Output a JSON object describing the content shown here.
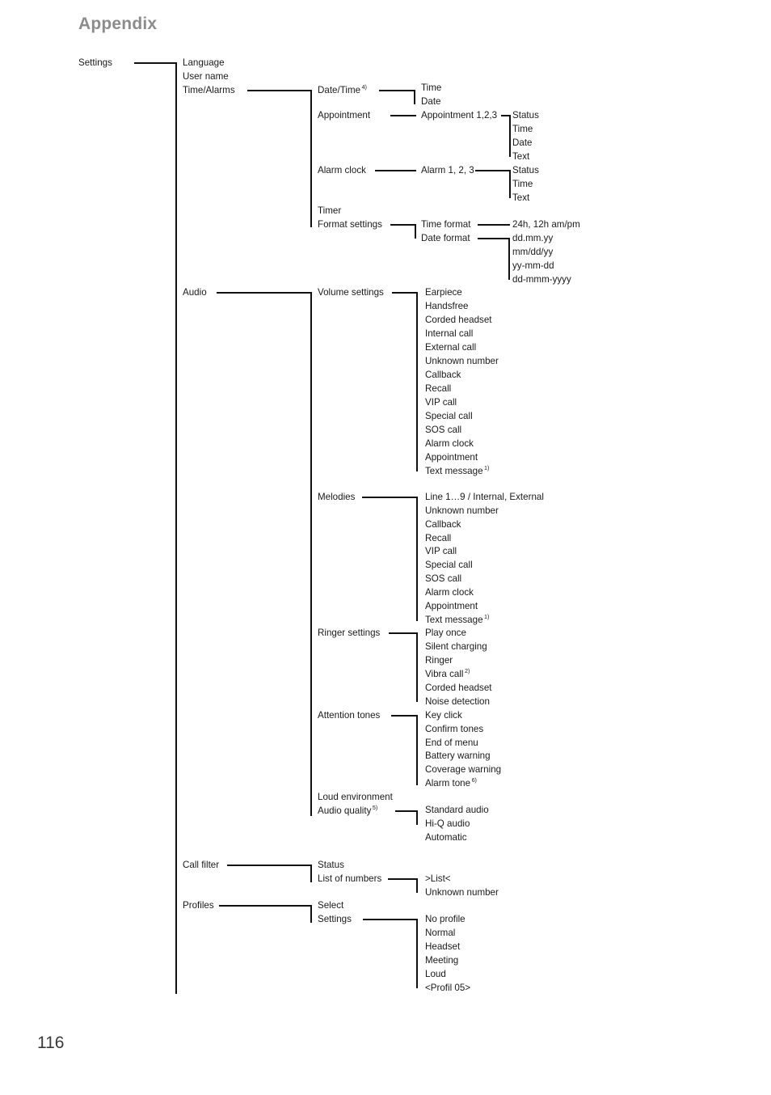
{
  "document": {
    "title": "Appendix",
    "page_number": "116"
  },
  "tree": {
    "root": {
      "label": "Settings"
    },
    "level1": [
      {
        "label": "Language"
      },
      {
        "label": "User name"
      },
      {
        "label": "Time/Alarms"
      },
      {
        "label": "Audio"
      },
      {
        "label": "Call filter"
      },
      {
        "label": "Profiles"
      }
    ],
    "level2": [
      {
        "label": "Date/Time",
        "footnote": "4)"
      },
      {
        "label": "Appointment"
      },
      {
        "label": "Alarm clock"
      },
      {
        "label": "Timer"
      },
      {
        "label": "Format settings"
      },
      {
        "label": "Volume settings"
      },
      {
        "label": "Melodies"
      },
      {
        "label": "Ringer settings"
      },
      {
        "label": "Attention tones"
      },
      {
        "label": "Loud environment"
      },
      {
        "label": "Audio quality",
        "footnote": "5)"
      },
      {
        "label": "Status"
      },
      {
        "label": "List of numbers"
      },
      {
        "label": "Select"
      },
      {
        "label": "Settings"
      }
    ],
    "level3": {
      "date_time": [
        "Time",
        "Date"
      ],
      "appointment": [
        "Appointment 1,2,3"
      ],
      "alarm_clock": [
        "Alarm 1, 2, 3"
      ],
      "format_settings": [
        "Time format",
        "Date format"
      ],
      "volume_settings": [
        "Earpiece",
        "Handsfree",
        "Corded headset",
        "Internal call",
        "External call",
        "Unknown number",
        "Callback",
        "Recall",
        "VIP call",
        "Special call",
        "SOS call",
        "Alarm clock",
        "Appointment"
      ],
      "volume_settings_last": {
        "label": "Text message",
        "footnote": "1)"
      },
      "melodies": [
        "Line 1…9 / Internal, External",
        "Unknown number",
        "Callback",
        "Recall",
        "VIP call",
        "Special call",
        "SOS call",
        "Alarm clock",
        "Appointment"
      ],
      "melodies_last": {
        "label": "Text message",
        "footnote": "1)"
      },
      "ringer_settings": [
        "Play once",
        "Silent charging",
        "Ringer"
      ],
      "ringer_settings_vibra": {
        "label": "Vibra call",
        "footnote": "2)"
      },
      "ringer_settings_rest": [
        "Corded headset",
        "Noise detection"
      ],
      "attention_tones": [
        "Key click",
        "Confirm tones",
        "End of menu",
        "Battery warning",
        "Coverage warning"
      ],
      "attention_tones_last": {
        "label": "Alarm tone",
        "footnote": "6)"
      },
      "audio_quality": [
        "Standard audio",
        "Hi-Q audio",
        "Automatic"
      ],
      "list_of_numbers": [
        ">List<",
        "Unknown number"
      ],
      "profile_settings": [
        "No profile",
        "Normal",
        "Headset",
        "Meeting",
        "Loud",
        "<Profil 05>"
      ]
    },
    "level4": {
      "appointment_123": [
        "Status",
        "Time",
        "Date",
        "Text"
      ],
      "alarm_123": [
        "Status",
        "Time",
        "Text"
      ],
      "time_format": [
        "24h, 12h am/pm"
      ],
      "date_format": [
        "dd.mm.yy",
        "mm/dd/yy",
        "yy-mm-dd",
        "dd-mmm-yyyy"
      ]
    }
  }
}
